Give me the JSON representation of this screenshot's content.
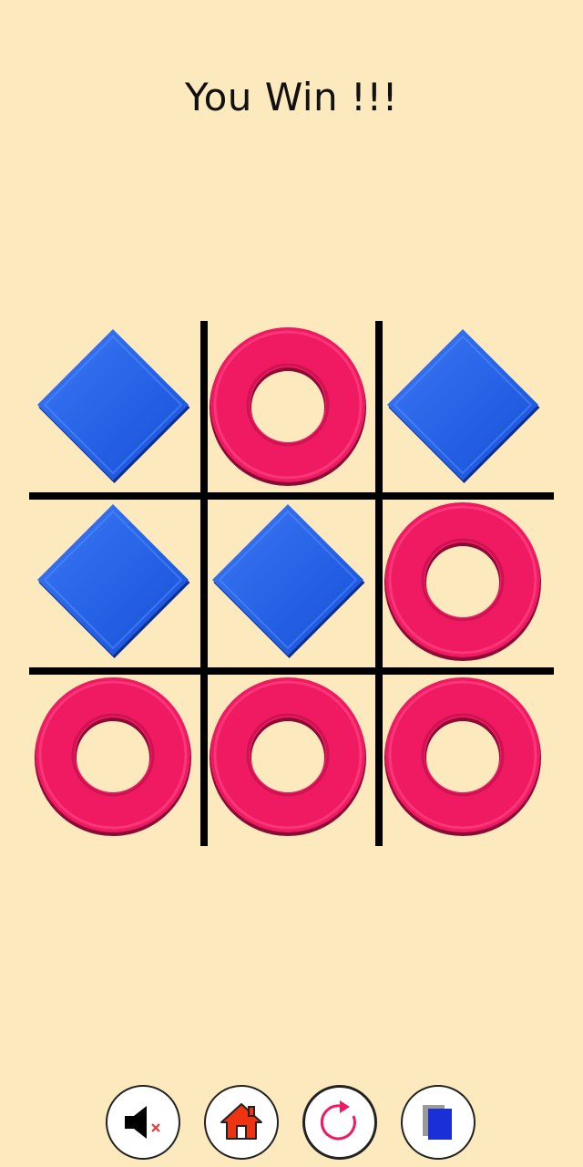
{
  "status_text": "You Win !!!",
  "board": {
    "cells": [
      "diamond",
      "ring",
      "diamond",
      "diamond",
      "diamond",
      "ring",
      "ring",
      "ring",
      "ring"
    ]
  },
  "colors": {
    "background": "#fce9be",
    "diamond": "#1f5fe6",
    "ring": "#f01a62",
    "grid": "#000000"
  },
  "toolbar": [
    {
      "name": "sound-muted-button",
      "icon": "speaker-muted-icon"
    },
    {
      "name": "home-button",
      "icon": "home-icon"
    },
    {
      "name": "restart-button",
      "icon": "restart-icon"
    },
    {
      "name": "cards-button",
      "icon": "cards-icon"
    }
  ]
}
